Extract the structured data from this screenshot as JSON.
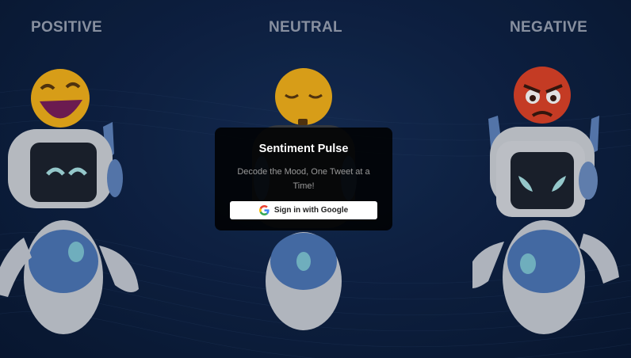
{
  "columns": {
    "positive": "POSITIVE",
    "neutral": "NEUTRAL",
    "negative": "NEGATIVE"
  },
  "modal": {
    "title": "Sentiment Pulse",
    "subtitle": "Decode the Mood, One Tweet at a Time!",
    "signin_label": "Sign in with Google"
  },
  "colors": {
    "background": "#0f2449",
    "modal_bg": "#000000",
    "button_bg": "#ffffff"
  },
  "icons": {
    "positive_emoji": "laughing-face-icon",
    "neutral_emoji": "sad-face-icon",
    "negative_emoji": "angry-face-icon",
    "google": "google-icon"
  }
}
